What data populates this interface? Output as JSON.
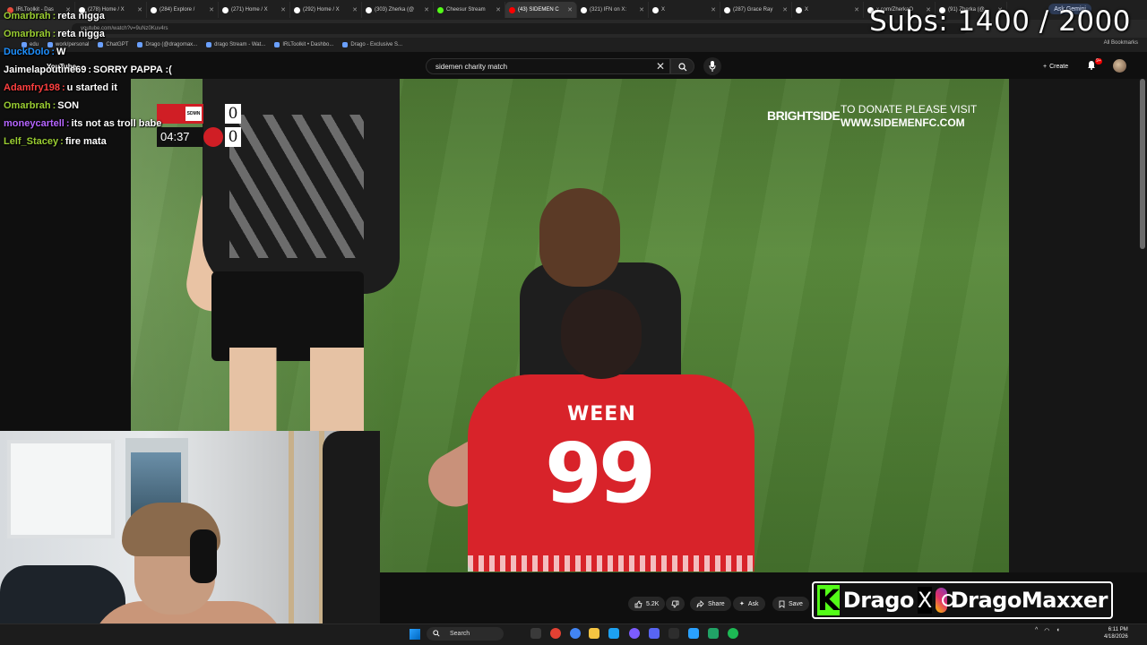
{
  "browser": {
    "tabs": [
      {
        "label": "IRLToolkit - Das",
        "color": "#e74c3c"
      },
      {
        "label": "(278) Home / X",
        "color": "#ffffff"
      },
      {
        "label": "(284) Explore /",
        "color": "#ffffff"
      },
      {
        "label": "(271) Home / X",
        "color": "#ffffff"
      },
      {
        "label": "(292) Home / X",
        "color": "#ffffff"
      },
      {
        "label": "(303) Zherka (@",
        "color": "#ffffff"
      },
      {
        "label": "Cheesur Stream",
        "color": "#53fc18"
      },
      {
        "label": "(43) SIDEMEN C",
        "color": "#ff0000",
        "active": true
      },
      {
        "label": "(321) IFN on X:",
        "color": "#ffffff"
      },
      {
        "label": "X",
        "color": "#ffffff"
      },
      {
        "label": "(287) Grace Ray",
        "color": "#ffffff"
      },
      {
        "label": "X",
        "color": "#ffffff"
      },
      {
        "label": "x.com/ZherkaO",
        "color": "#ffffff"
      },
      {
        "label": "(91) Zherka (@",
        "color": "#ffffff"
      }
    ],
    "ask_gemini": "Ask Gemini",
    "url": "youtube.com/watch?v=9uNz0Kuv4rs",
    "bookmarks": [
      {
        "label": "edu"
      },
      {
        "label": "work/personal"
      },
      {
        "label": "ChatGPT"
      },
      {
        "label": "Drago (@dragomax..."
      },
      {
        "label": "drago Stream - Wat..."
      },
      {
        "label": "IRLToolkit • Dashbo..."
      },
      {
        "label": "Drago - Exclusive S..."
      }
    ],
    "all_bookmarks": "All Bookmarks"
  },
  "youtube": {
    "logo": "YouTube",
    "search_value": "sidemen charity match",
    "create_label": "Create",
    "notification_count": "9+",
    "actions": {
      "like_count": "5.2K",
      "share": "Share",
      "ask": "Ask",
      "save": "Save"
    }
  },
  "video": {
    "scoreboard": {
      "team1_short": "SDMN",
      "score1": "0",
      "clock": "04:37",
      "score2": "0"
    },
    "sponsor": "BRIGHTSIDE",
    "donate_line1": "TO DONATE PLEASE VISIT",
    "donate_line2": "WWW.SIDEMENFC.COM",
    "jersey_name": "WEEN",
    "jersey_number": "99"
  },
  "overlay": {
    "subs_goal": "Subs: 1400 / 2000",
    "chat": [
      {
        "user": "Omarbrah",
        "message": "reta nigga",
        "color": "#9acd32"
      },
      {
        "user": "Omarbrah",
        "message": "reta nigga",
        "color": "#9acd32"
      },
      {
        "user": "DuckDolo",
        "message": "W",
        "color": "#1e90ff"
      },
      {
        "user": "Jaimelapoutine69",
        "message": "SORRY PAPPA :(",
        "color": "#ffffff"
      },
      {
        "user": "Adamfry198",
        "message": "u started it",
        "color": "#ff4040"
      },
      {
        "user": "Omarbrah",
        "message": "SON",
        "color": "#9acd32"
      },
      {
        "user": "moneycartell",
        "message": "its not as troll babe",
        "color": "#b565ff"
      },
      {
        "user": "Lelf_Stacey",
        "message": "fire mata",
        "color": "#9acd32"
      }
    ],
    "socials": {
      "kick_letter": "K",
      "name1": "Drago",
      "x_letter": "X",
      "name2": "DragoMaxxer"
    }
  },
  "taskbar": {
    "search_label": "Search",
    "time": "6:11 PM",
    "date": "4/18/2026"
  }
}
